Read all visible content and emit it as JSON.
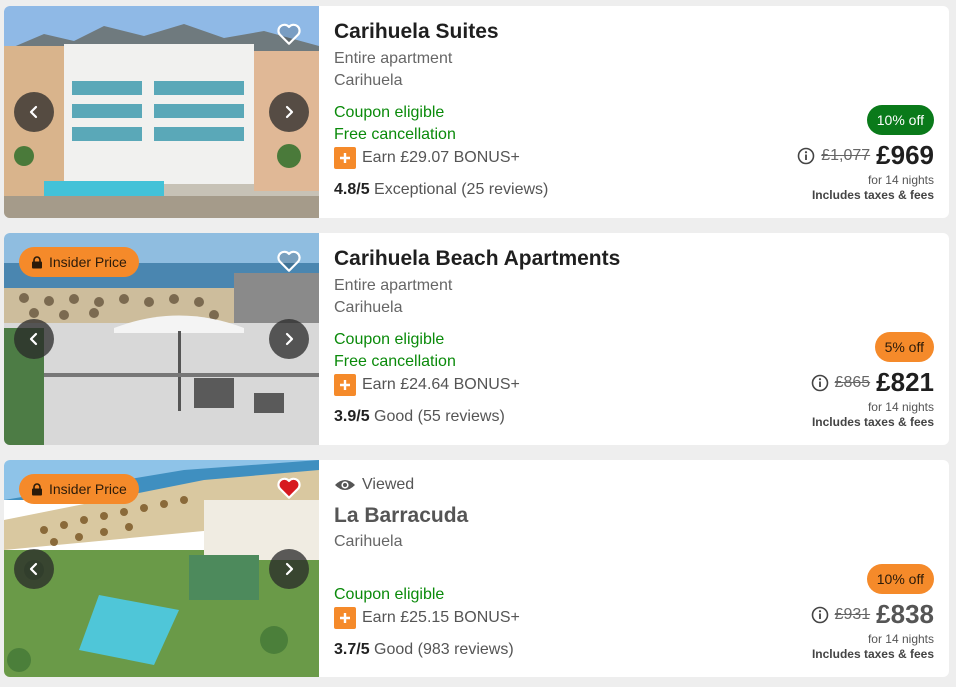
{
  "results": [
    {
      "insider_price": "",
      "viewed_label": "",
      "name": "Carihuela Suites",
      "type": "Entire apartment",
      "area": "Carihuela",
      "coupon": "Coupon eligible",
      "free_cancellation": "Free cancellation",
      "bonus": "Earn £29.07 BONUS+",
      "rating_score": "4.8/5",
      "rating_text": "Exceptional (25 reviews)",
      "discount": "10% off",
      "discount_color": "#0a7a1a",
      "old_price": "£1,077",
      "price": "£969",
      "nights": "for 14 nights",
      "taxes": "Includes taxes & fees",
      "saved": false
    },
    {
      "insider_price": "Insider Price",
      "viewed_label": "",
      "name": "Carihuela Beach Apartments",
      "type": "Entire apartment",
      "area": "Carihuela",
      "coupon": "Coupon eligible",
      "free_cancellation": "Free cancellation",
      "bonus": "Earn £24.64 BONUS+",
      "rating_score": "3.9/5",
      "rating_text": "Good (55 reviews)",
      "discount": "5% off",
      "discount_color": "#f58a2a",
      "old_price": "£865",
      "price": "£821",
      "nights": "for 14 nights",
      "taxes": "Includes taxes & fees",
      "saved": false
    },
    {
      "insider_price": "Insider Price",
      "viewed_label": "Viewed",
      "name": "La Barracuda",
      "type": "",
      "area": "Carihuela",
      "coupon": "Coupon eligible",
      "free_cancellation": "",
      "bonus": "Earn £25.15 BONUS+",
      "rating_score": "3.7/5",
      "rating_text": "Good (983 reviews)",
      "discount": "10% off",
      "discount_color": "#f58a2a",
      "old_price": "£931",
      "price": "£838",
      "nights": "for 14 nights",
      "taxes": "Includes taxes & fees",
      "saved": true
    }
  ],
  "icons": {
    "heart": "heart-icon",
    "prev": "chevron-left-icon",
    "next": "chevron-right-icon",
    "lock": "lock-icon",
    "plus": "plus-icon",
    "info": "info-icon",
    "eye": "eye-icon"
  },
  "colors": {
    "green_text": "#0a8a0a",
    "orange": "#f58a2a",
    "green_badge": "#0a7a1a",
    "saved_heart": "#d71920"
  }
}
